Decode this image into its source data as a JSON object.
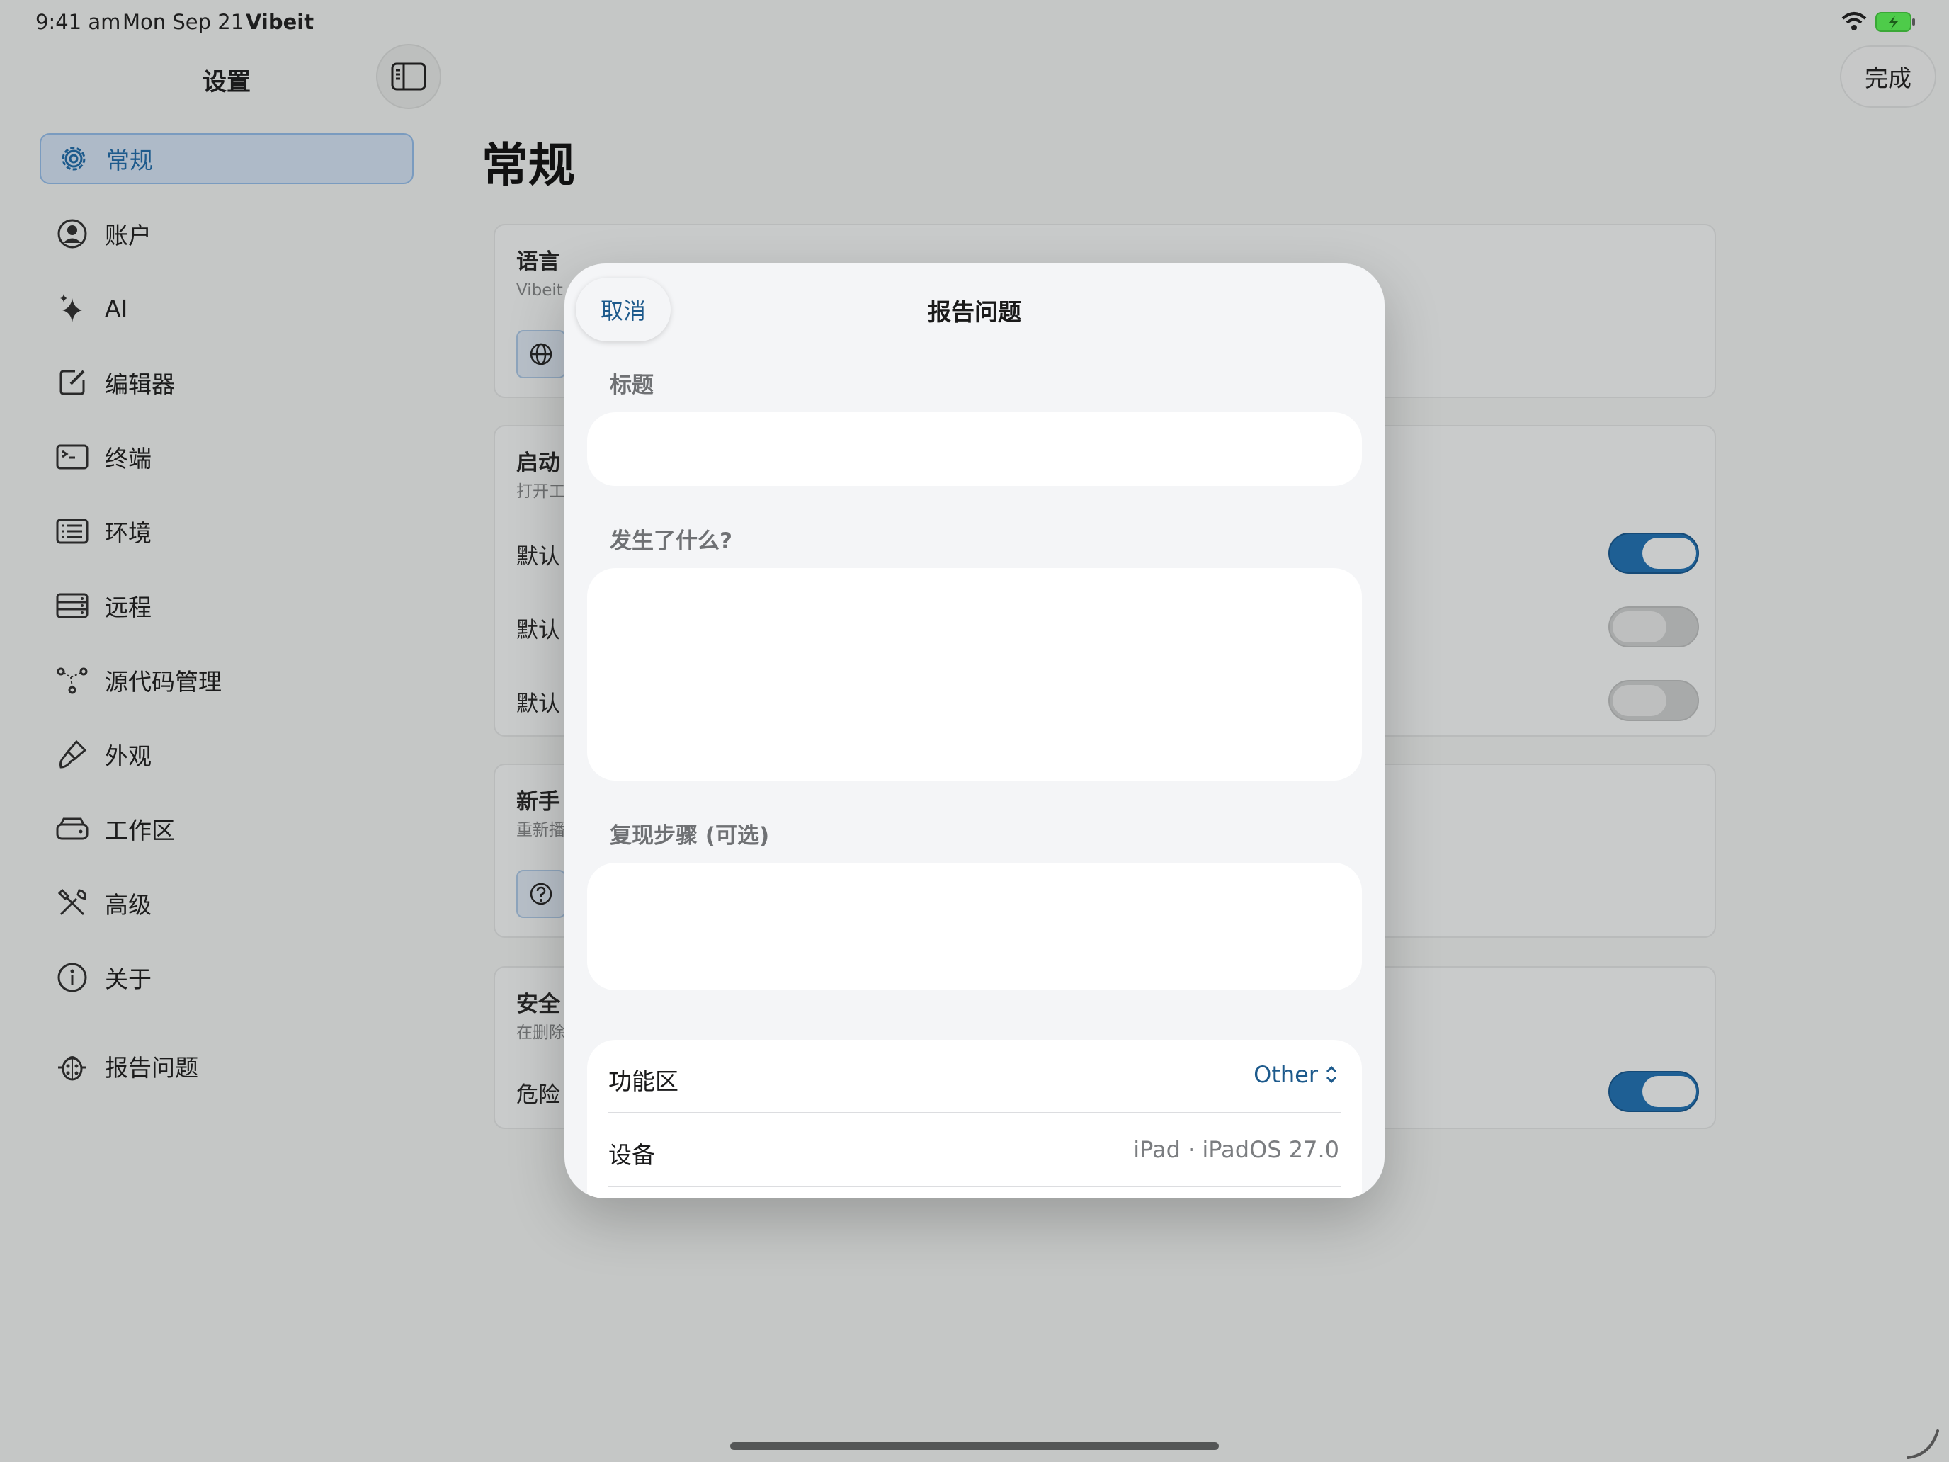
{
  "status_bar": {
    "time": "9:41 am",
    "date": "Mon Sep 21",
    "app": "Vibeit"
  },
  "sidebar": {
    "title": "设置",
    "items": [
      {
        "label": "常规",
        "icon": "gear-icon",
        "selected": true
      },
      {
        "label": "账户",
        "icon": "person-circle-icon"
      },
      {
        "label": "AI",
        "icon": "sparkles-icon"
      },
      {
        "label": "编辑器",
        "icon": "square-pencil-icon"
      },
      {
        "label": "终端",
        "icon": "terminal-icon"
      },
      {
        "label": "环境",
        "icon": "list-icon"
      },
      {
        "label": "远程",
        "icon": "server-icon"
      },
      {
        "label": "源代码管理",
        "icon": "branch-icon"
      },
      {
        "label": "外观",
        "icon": "paintbrush-icon"
      },
      {
        "label": "工作区",
        "icon": "drive-icon"
      },
      {
        "label": "高级",
        "icon": "tools-icon"
      },
      {
        "label": "关于",
        "icon": "info-icon"
      },
      {
        "label": "报告问题",
        "icon": "ladybug-icon"
      }
    ]
  },
  "toolbar": {
    "done_label": "完成"
  },
  "main": {
    "title": "常规",
    "cards": {
      "language": {
        "title": "语言",
        "subtitle": "Vibeit 显"
      },
      "startup": {
        "title": "启动",
        "subtitle": "打开工",
        "rows": [
          "默认",
          "默认",
          "默认"
        ],
        "toggles": [
          true,
          false,
          false
        ]
      },
      "onboarding": {
        "title": "新手",
        "subtitle": "重新播"
      },
      "safety": {
        "title": "安全",
        "subtitle": "在删除",
        "row": "危险",
        "toggle": true
      }
    }
  },
  "modal": {
    "cancel_label": "取消",
    "title": "报告问题",
    "fields": {
      "title_label": "标题",
      "title_value": "",
      "what_label": "发生了什么?",
      "what_value": "",
      "steps_label": "复现步骤 (可选)",
      "steps_value": ""
    },
    "info": {
      "area_label": "功能区",
      "area_value": "Other",
      "device_label": "设备",
      "device_value": "iPad · iPadOS 27.0"
    }
  },
  "colors": {
    "accent": "#1d5a8c",
    "toggle_on": "#1e5f94",
    "background": "#c5c7c6",
    "sheet": "#f4f5f7"
  }
}
